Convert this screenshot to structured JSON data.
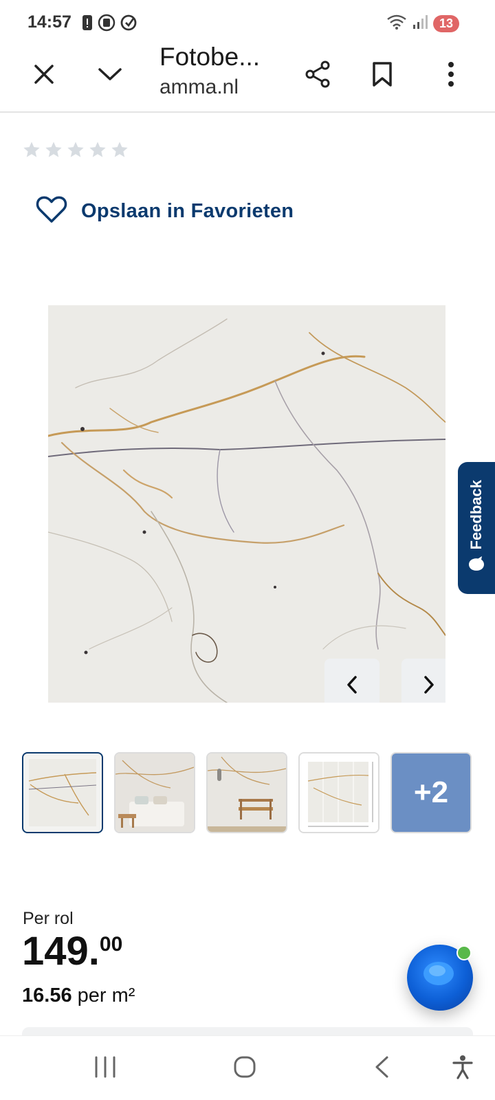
{
  "status_bar": {
    "time": "14:57",
    "battery_level": "13",
    "icons_left": [
      "notification-icon",
      "screen-record-icon",
      "sync-icon"
    ],
    "icons_right": [
      "wifi-icon",
      "signal-icon"
    ]
  },
  "toolbar": {
    "title": "Fotobe...",
    "url": "amma.nl",
    "icons": [
      "close-icon",
      "chevron-down-icon",
      "share-icon",
      "bookmark-icon",
      "more-vert-icon"
    ]
  },
  "rating": {
    "stars_filled": 0,
    "stars_total": 5
  },
  "favorite": {
    "label": "Opslaan in Favorieten"
  },
  "gallery": {
    "feedback_label": "Feedback",
    "thumbnails_more_label": "+2"
  },
  "price": {
    "per_unit_label": "Per rol",
    "integer": "149",
    "decimal": "00",
    "unit_price_value": "16.56",
    "unit_price_label": "per m²"
  },
  "colors": {
    "brand_navy": "#0b3a6e",
    "chat_blue": "#0d5fd6",
    "online_green": "#58b84a",
    "battery_red": "#e06666"
  }
}
